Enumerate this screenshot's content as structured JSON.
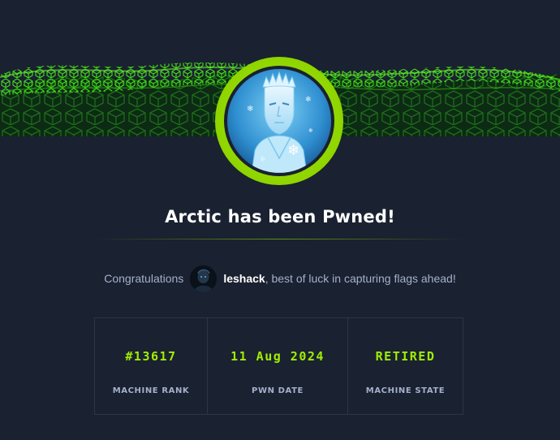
{
  "machine": {
    "name": "Arctic",
    "title": "Arctic has been Pwned!"
  },
  "congrats": {
    "prefix": "Congratulations",
    "username": "leshack",
    "suffix": ", best of luck in capturing flags ahead!"
  },
  "stats": [
    {
      "value": "#13617",
      "label": "MACHINE RANK"
    },
    {
      "value": "11 Aug 2024",
      "label": "PWN DATE"
    },
    {
      "value": "RETIRED",
      "label": "MACHINE STATE"
    }
  ],
  "colors": {
    "accent": "#9fef00",
    "background": "#1a2130",
    "muted_text": "#a4b1cd"
  },
  "icons": {
    "banner": "green-cube-wave-banner",
    "machine_avatar": "ice-king-avatar",
    "user_avatar": "user-avatar"
  }
}
